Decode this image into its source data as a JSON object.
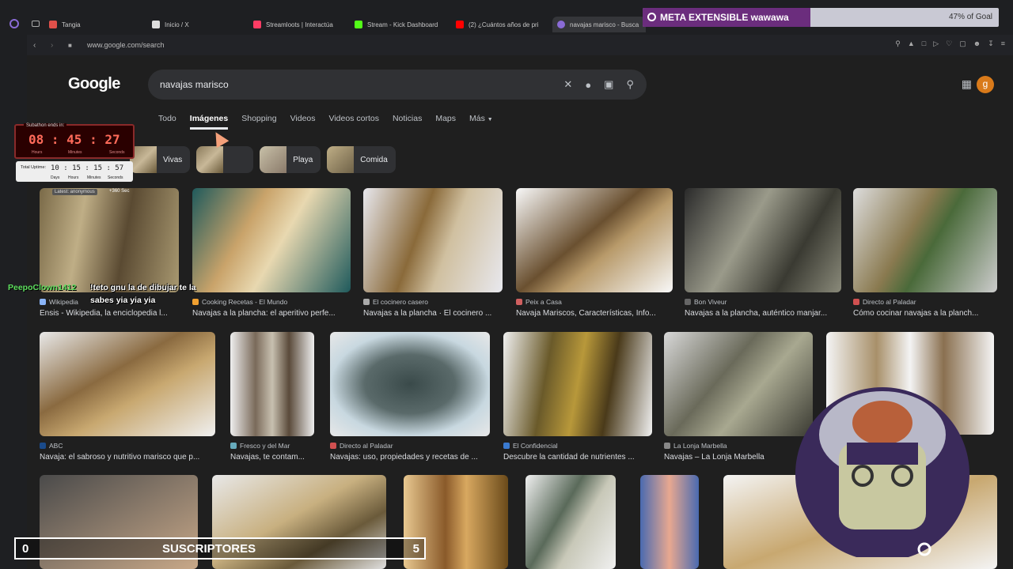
{
  "browser": {
    "tabs": [
      {
        "label": "Tangia",
        "color": "#e0504a"
      },
      {
        "label": "Inicio / X",
        "color": "#dddddd"
      },
      {
        "label": "Streamloots | Interactúa",
        "color": "#ff3c64"
      },
      {
        "label": "Stream - Kick Dashboard",
        "color": "#53fc18"
      },
      {
        "label": "(2) ¿Cuántos años de pri",
        "color": "#ff0000"
      },
      {
        "label": "navajas marisco - Busca",
        "color": "#8a6bd6"
      }
    ],
    "url": "www.google.com/search"
  },
  "google": {
    "logo": "Google",
    "query": "navajas marisco",
    "tabs": [
      "Todo",
      "Imágenes",
      "Shopping",
      "Videos",
      "Videos cortos",
      "Noticias",
      "Maps",
      "Más"
    ],
    "active_tab": "Imágenes",
    "avatar_letter": "g",
    "chips": [
      "Vivas",
      "Playa",
      "Comida"
    ]
  },
  "results_row1": [
    {
      "source": "Wikipedia",
      "caption": "Ensis - Wikipedia, la enciclopedia l..."
    },
    {
      "source": "Cooking Recetas - El Mundo",
      "caption": "Navajas a la plancha: el aperitivo perfe..."
    },
    {
      "source": "El cocinero casero",
      "caption": "Navajas a la plancha · El cocinero ..."
    },
    {
      "source": "Peix a Casa",
      "caption": "Navaja Mariscos, Características, Info..."
    },
    {
      "source": "Bon Viveur",
      "caption": "Navajas a la plancha, auténtico manjar..."
    },
    {
      "source": "Directo al Paladar",
      "caption": "Cómo cocinar navajas a la planch..."
    }
  ],
  "results_row2": [
    {
      "source": "ABC",
      "caption": "Navaja: el sabroso y nutritivo marisco que p..."
    },
    {
      "source": "Fresco y del Mar",
      "caption": "Navajas, te contam..."
    },
    {
      "source": "Directo al Paladar",
      "caption": "Navajas: uso, propiedades y recetas de ..."
    },
    {
      "source": "El Confidencial",
      "caption": "Descubre la cantidad de nutrientes ..."
    },
    {
      "source": "La Lonja Marbella",
      "caption": "Navajas – La Lonja Marbella"
    }
  ],
  "overlay": {
    "goal_label": "META EXTENSIBLE wawawa",
    "goal_percent_text": "47% of Goal",
    "goal_fraction": 0.47,
    "timer_header": "Subathon ends in:",
    "timer": {
      "h": "08",
      "m": "45",
      "s": "27"
    },
    "timer_units": {
      "h": "Hours",
      "m": "Minutes",
      "s": "Seconds"
    },
    "uptime_label": "Total Uptime:",
    "uptime": "10 : 15 : 15 : 57",
    "uptime_units": [
      "Days",
      "Hours",
      "Minutes",
      "Seconds"
    ],
    "latest": "Latest: anonymous",
    "latest_bonus": "+360 Sec",
    "chat_user": "PeepoClown1412",
    "chat_line1": "!teto gnu la de dibujar te la",
    "chat_line2": "sabes yia yia yia",
    "subs_left": "0",
    "subs_label": "SUSCRIPTORES",
    "subs_right": "5"
  }
}
